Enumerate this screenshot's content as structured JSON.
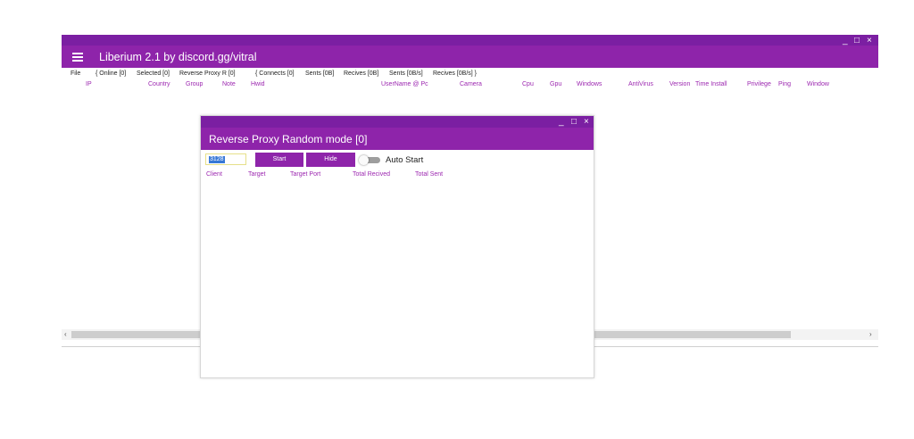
{
  "app": {
    "title": "Liberium 2.1 by discord.gg/vitral",
    "window_controls": {
      "minimize": "_",
      "maximize": "□",
      "close": "×"
    }
  },
  "menubar": {
    "items": [
      "File",
      "{ Online [0]",
      "Selected [0]",
      "Reverse Proxy R [0]",
      "{ Connects [0]",
      "Sents [0B]",
      "Recives [0B]",
      "Sents [0B/s]",
      "Recives [0B/s] }"
    ]
  },
  "clients_table": {
    "columns": [
      "IP",
      "Country",
      "Group",
      "Note",
      "Hwid",
      "UserName @ Pc",
      "Camera",
      "Cpu",
      "Gpu",
      "Windows",
      "AntiVirus",
      "Version",
      "Time Install",
      "Privilege",
      "Ping",
      "Window"
    ]
  },
  "scrollbar": {
    "left_arrow": "‹",
    "right_arrow": "›"
  },
  "dialog": {
    "title": "Reverse Proxy Random mode [0]",
    "window_controls": {
      "minimize": "_",
      "maximize": "□",
      "close": "×"
    },
    "port_value": "3128",
    "start_label": "Start",
    "hide_label": "Hide",
    "auto_start_label": "Auto Start",
    "auto_start_enabled": false,
    "columns": [
      "Client",
      "Target",
      "Target Port",
      "Total Recived",
      "Total Sent"
    ]
  },
  "colors": {
    "accent": "#8e24aa",
    "accent_dark": "#7b1fa2",
    "column_text": "#9c27b0"
  }
}
